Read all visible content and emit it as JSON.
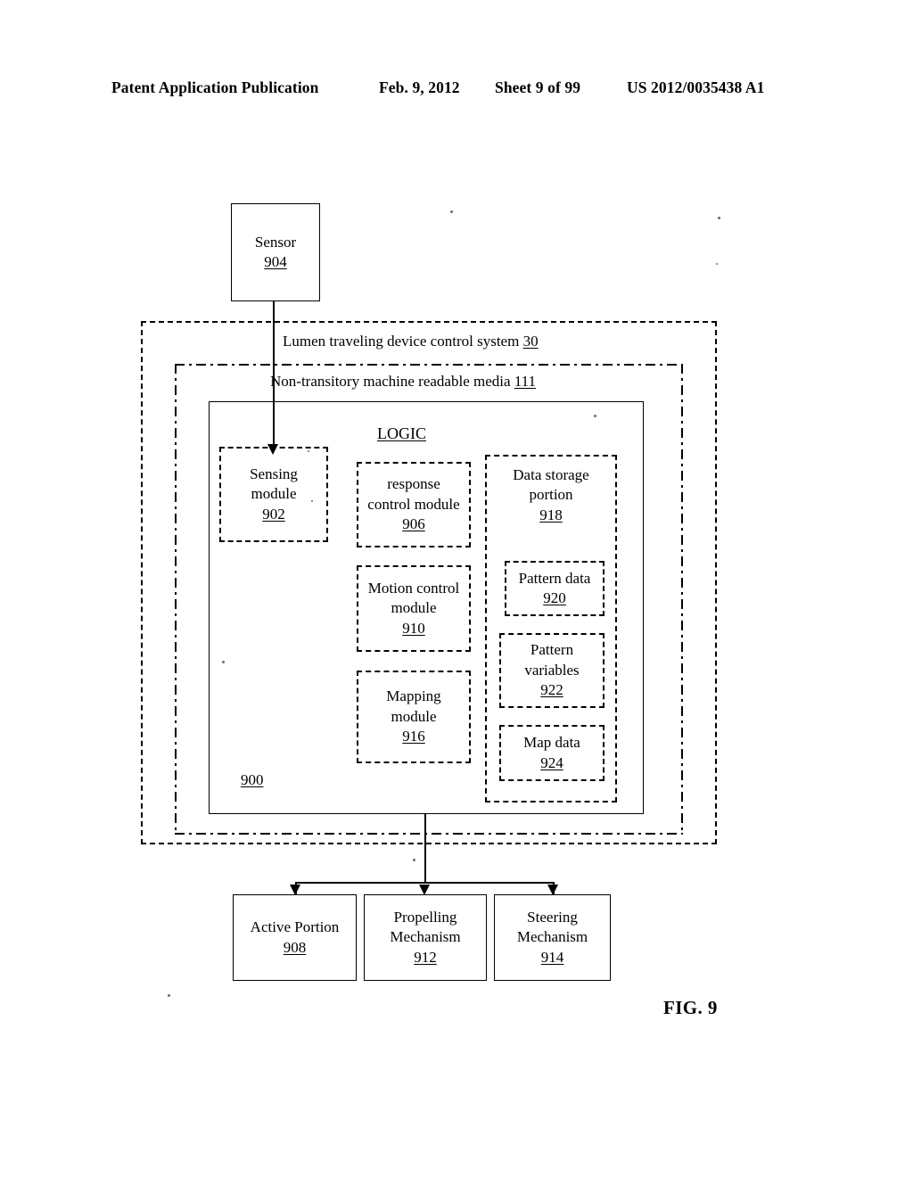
{
  "header": {
    "title": "Patent Application Publication",
    "date": "Feb. 9, 2012",
    "sheet": "Sheet 9 of 99",
    "publication_number": "US 2012/0035438 A1"
  },
  "figure": {
    "caption": "FIG. 9",
    "system_reference": "900"
  },
  "sensor": {
    "label": "Sensor",
    "ref": "904"
  },
  "outer_container": {
    "label": "Lumen traveling device control system",
    "ref": "30"
  },
  "media_container": {
    "label": "Non-transitory machine readable media",
    "ref": "111"
  },
  "logic": {
    "title": "LOGIC",
    "modules": [
      {
        "label_line1": "Sensing",
        "label_line2": "module",
        "ref": "902"
      },
      {
        "label_line1": "response",
        "label_line2": "control module",
        "ref": "906"
      },
      {
        "label_line1": "Motion control",
        "label_line2": "module",
        "ref": "910"
      },
      {
        "label_line1": "Mapping",
        "label_line2": "module",
        "ref": "916"
      }
    ],
    "data_storage": {
      "label_line1": "Data storage",
      "label_line2": "portion",
      "ref": "918",
      "items": [
        {
          "label_line1": "Pattern data",
          "label_line2": "",
          "ref": "920"
        },
        {
          "label_line1": "Pattern",
          "label_line2": "variables",
          "ref": "922"
        },
        {
          "label_line1": "Map data",
          "label_line2": "",
          "ref": "924"
        }
      ]
    }
  },
  "outputs": [
    {
      "label_line1": "Active Portion",
      "label_line2": "",
      "ref": "908"
    },
    {
      "label_line1": "Propelling",
      "label_line2": "Mechanism",
      "ref": "912"
    },
    {
      "label_line1": "Steering",
      "label_line2": "Mechanism",
      "ref": "914"
    }
  ],
  "colors": {
    "ink": "#000000",
    "page": "#ffffff"
  }
}
